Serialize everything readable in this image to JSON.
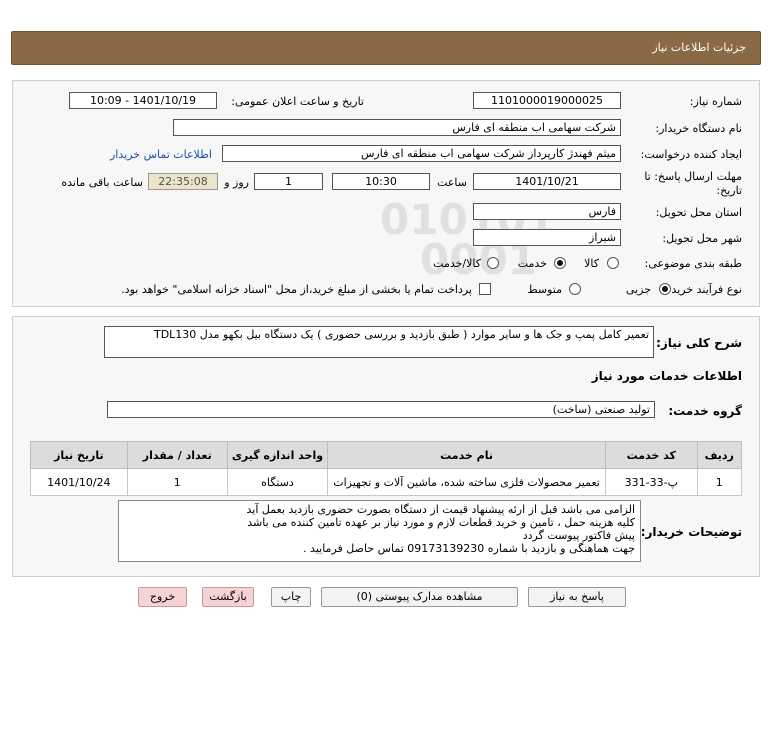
{
  "header": {
    "title": "جزئیات اطلاعات نیاز"
  },
  "form": {
    "need_number_label": "شماره نیاز:",
    "need_number": "1101000019000025",
    "announce_label": "تاریخ و ساعت اعلان عمومی:",
    "announce_value": "1401/10/19 - 10:09",
    "buyer_org_label": "نام دستگاه خریدار:",
    "buyer_org": "شرکت سهامی اب منطقه ای فارس",
    "creator_label": "ایجاد کننده درخواست:",
    "creator": "میثم فهندژ کارپرداز شرکت سهامی اب منطقه ای فارس",
    "contact_link": "اطلاعات تماس خریدار",
    "deadline_label_1": "مهلت ارسال پاسخ: تا",
    "deadline_label_2": "تاریخ:",
    "deadline_date": "1401/10/21",
    "time_label": "ساعت",
    "deadline_time": "10:30",
    "days_value": "1",
    "days_label": "روز و",
    "remaining_value": "22:35:08",
    "remaining_label": "ساعت باقی مانده",
    "province_label": "استان محل تحویل:",
    "province": "فارس",
    "city_label": "شهر محل تحویل:",
    "city": "شیراز",
    "category_label": "طبقه بندی موضوعی:",
    "category_options": [
      "کالا",
      "خدمت",
      "کالا/خدمت"
    ],
    "category_selected": "خدمت",
    "process_label": "نوع فرآیند خرید :",
    "process_options": [
      "جزیی",
      "متوسط"
    ],
    "process_selected": "جزیی",
    "treasury_text": "پرداخت تمام یا بخشی از مبلغ خرید،از محل \"اسناد خزانه اسلامی\" خواهد بود."
  },
  "description": {
    "label": "شرح کلی نیاز:",
    "text": "تعمیر کامل پمپ و جک ها و سایر موارد ( طبق بازدید و بررسی حضوری ) یک دستگاه بیل بکهو مدل TDL130"
  },
  "services": {
    "section_title": "اطلاعات خدمات مورد نیاز",
    "group_label": "گروه خدمت:",
    "group_value": "تولید صنعتی (ساخت)",
    "columns": [
      "ردیف",
      "کد خدمت",
      "نام خدمت",
      "واحد اندازه گیری",
      "تعداد / مقدار",
      "تاریخ نیاز"
    ],
    "rows": [
      [
        "1",
        "پ-33-331",
        "تعمیر محصولات فلزی ساخته شده، ماشین آلات و تجهیزات",
        "دستگاه",
        "1",
        "1401/10/24"
      ]
    ]
  },
  "notes": {
    "label": "توضیحات خریدار:",
    "lines": [
      "الزامی می باشد قبل از ارئه پیشنهاد قیمت از دستگاه بصورت حضوری بازدید بعمل آید",
      "کلیه هزینه حمل ، تامین و خرید قطعات لازم و مورد نیاز بر عهده تامین کننده می باشد",
      "پیش فاکتور پیوست گردد",
      "جهت هماهنگی و بازدید با شماره 09173139230 تماس حاصل فرمایید ."
    ]
  },
  "buttons": {
    "reply": "پاسخ به نیاز",
    "attachments": "مشاهده مدارک پیوستی (0)",
    "print": "چاپ",
    "back": "بازگشت",
    "exit": "خروج"
  },
  "watermark": {
    "logo_text": "ParsNamadData",
    "digits_1": "010101",
    "digits_2": "0001"
  },
  "colors": {
    "header_bg": "#8a6a44",
    "panel_bg": "#f7f7f7",
    "link": "#1a4fa8",
    "remaining_bg": "#ece4c8"
  }
}
